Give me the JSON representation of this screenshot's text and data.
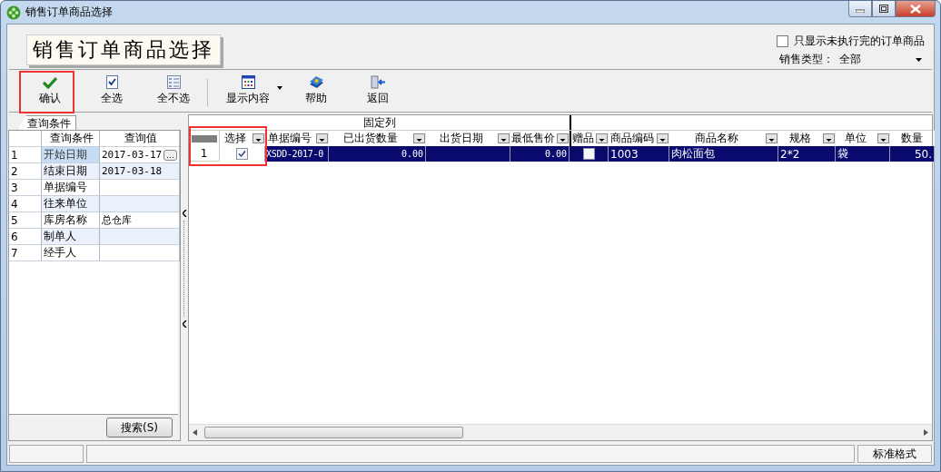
{
  "window": {
    "title": "销售订单商品选择"
  },
  "header": {
    "title": "销售订单商品选择",
    "only_unfinished": {
      "label": "只显示未执行完的订单商品",
      "checked": false
    },
    "sales_type": {
      "label": "销售类型：",
      "value": "全部"
    }
  },
  "toolbar": [
    {
      "label": "确认",
      "has_menu": false
    },
    {
      "label": "全选",
      "has_menu": false
    },
    {
      "label": "全不选",
      "has_menu": false
    },
    {
      "label": "显示内容",
      "has_menu": true
    },
    {
      "label": "帮助",
      "has_menu": false
    },
    {
      "label": "返回",
      "has_menu": false
    }
  ],
  "query_panel": {
    "tab": "查询条件",
    "columns": [
      "查询条件",
      "查询值"
    ],
    "rows": [
      {
        "index": "1",
        "name": "开始日期",
        "value": "2017-03-17",
        "button": "…",
        "selected": true
      },
      {
        "index": "2",
        "name": "结束日期",
        "value": "2017-03-18",
        "selected": false
      },
      {
        "index": "3",
        "name": "单据编号",
        "selected": false
      },
      {
        "index": "4",
        "name": "往来单位",
        "selected": false
      },
      {
        "index": "5",
        "name": "库房名称",
        "value": "总仓库",
        "selected": false
      },
      {
        "index": "6",
        "name": "制单人",
        "selected": false
      },
      {
        "index": "7",
        "name": "经手人",
        "selected": false
      }
    ],
    "search_button": "搜索(S)"
  },
  "grid": {
    "group_label": "固定列",
    "columns": [
      {
        "label": "选择",
        "filter": true
      },
      {
        "label": "单据编号",
        "filter": true
      },
      {
        "label": "已出货数量",
        "filter": true
      },
      {
        "label": "出货日期",
        "filter": true
      },
      {
        "label": "最低售价",
        "filter": true
      },
      {
        "label": "赠品",
        "filter": true
      },
      {
        "label": "商品编码",
        "filter": true
      },
      {
        "label": "商品名称",
        "filter": true
      },
      {
        "label": "规格",
        "filter": true
      },
      {
        "label": "单位",
        "filter": true
      },
      {
        "label": "数量",
        "filter": false
      }
    ],
    "rows": [
      {
        "number": "1",
        "selected": true,
        "cells": [
          {
            "kind": "check",
            "checked": true
          },
          {
            "kind": "text",
            "text": "XSDD-2017-0"
          },
          {
            "kind": "text",
            "text": "0.00"
          },
          {
            "kind": "empty"
          },
          {
            "kind": "text",
            "text": "0.00"
          },
          {
            "kind": "check",
            "checked": false
          },
          {
            "kind": "text",
            "text": "1003"
          },
          {
            "kind": "text",
            "text": "肉松面包"
          },
          {
            "kind": "text",
            "text": "2*2"
          },
          {
            "kind": "text",
            "text": "袋"
          },
          {
            "kind": "text",
            "text": "50."
          }
        ]
      }
    ]
  },
  "status_bar": {
    "panels": [
      "标准格式"
    ]
  }
}
